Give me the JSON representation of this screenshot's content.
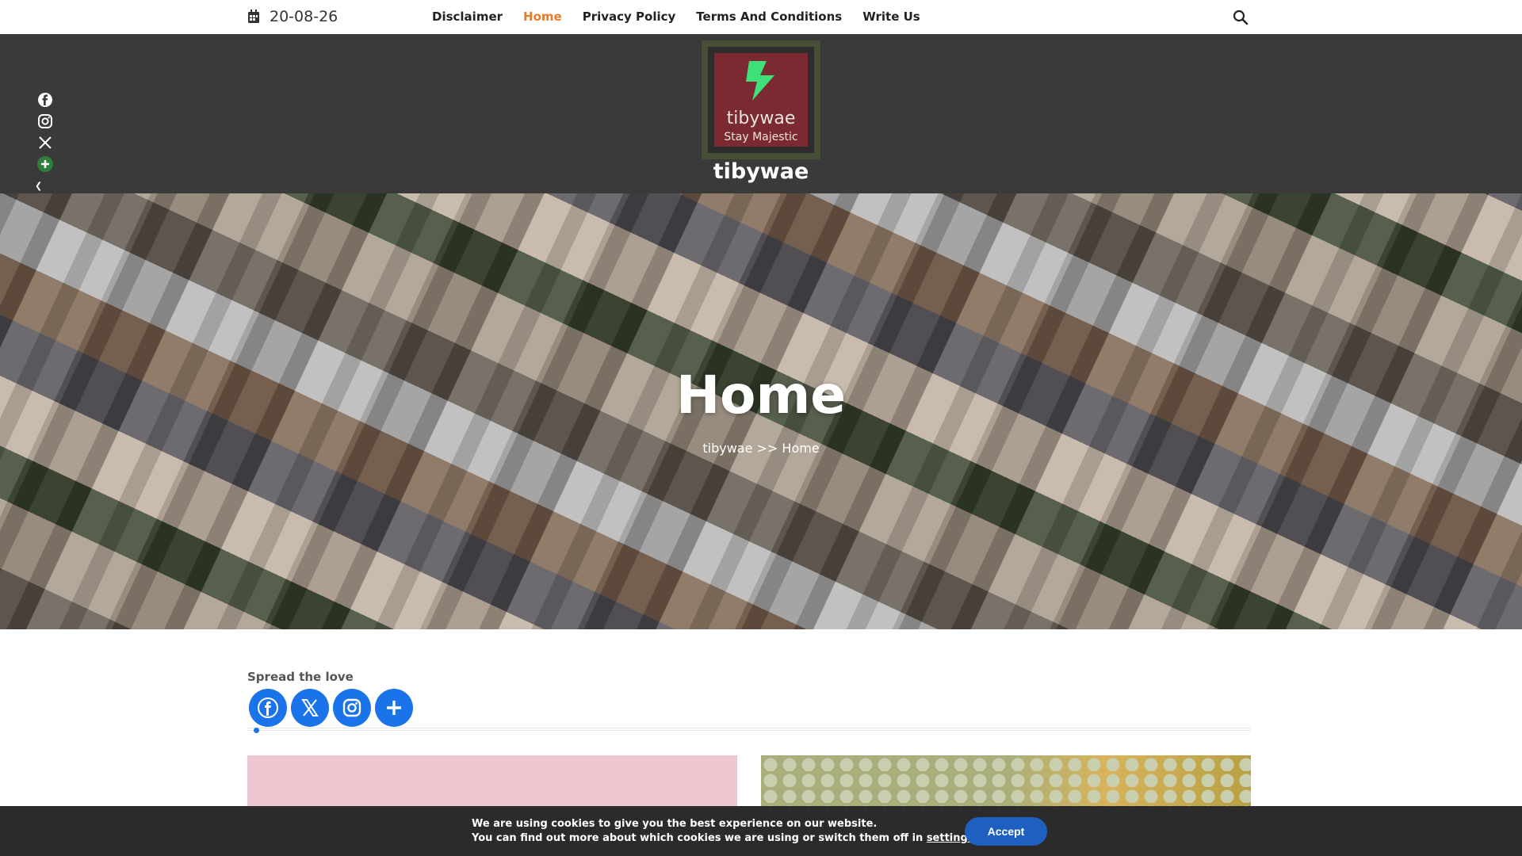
{
  "topbar": {
    "date": "20-08-26",
    "nav": [
      {
        "label": "Disclaimer",
        "active": false
      },
      {
        "label": "Home",
        "active": true
      },
      {
        "label": "Privacy Policy",
        "active": false
      },
      {
        "label": "Terms And Conditions",
        "active": false
      },
      {
        "label": "Write Us",
        "active": false
      }
    ],
    "search_icon": "search-icon",
    "active_color": "#e87b2a"
  },
  "header": {
    "logo_name": "tibywae",
    "logo_tagline": "Stay Majestic",
    "site_title": "tibywae",
    "bolt_color": "#3ee07a"
  },
  "side_share": {
    "icons": [
      "facebook-icon",
      "instagram-icon",
      "x-icon",
      "plus-icon"
    ],
    "hide_glyph": "❮"
  },
  "hero": {
    "title": "Home",
    "breadcrumb": "tibywae >> Home"
  },
  "content": {
    "spread_label": "Spread the love",
    "share_buttons": [
      "facebook-icon",
      "x-icon",
      "instagram-icon",
      "plus-icon"
    ],
    "share_color": "#1a73e8"
  },
  "cookie": {
    "line1": "We are using cookies to give you the best experience on our website.",
    "line2_prefix": "You can find out more about which cookies we are using or switch them off in ",
    "line2_link": "settings",
    "line2_suffix": ".",
    "accept_label": "Accept",
    "accept_color": "#1f5fbf"
  }
}
